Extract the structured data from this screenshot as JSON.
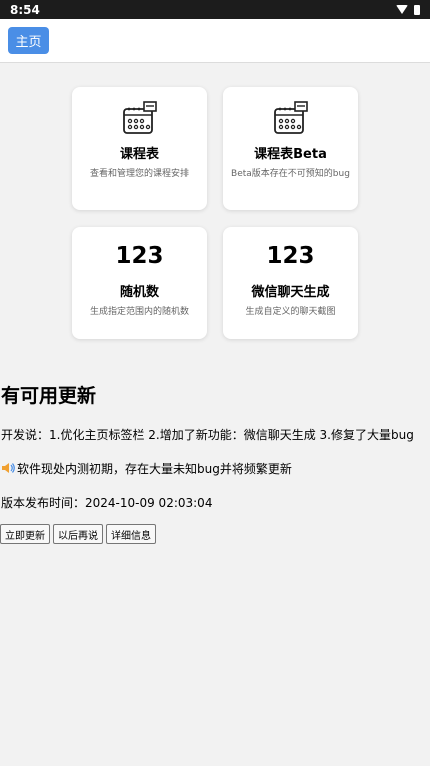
{
  "status_bar": {
    "time": "8:54"
  },
  "topbar": {
    "home_label": "主页"
  },
  "cards": [
    {
      "title": "课程表",
      "desc": "查看和管理您的课程安排",
      "icon": "calendar-grid-icon"
    },
    {
      "title": "课程表Beta",
      "desc": "Beta版本存在不可预知的bug",
      "icon": "calendar-grid-icon"
    },
    {
      "number": "123",
      "title": "随机数",
      "desc": "生成指定范围内的随机数"
    },
    {
      "number": "123",
      "title": "微信聊天生成",
      "desc": "生成自定义的聊天截图"
    }
  ],
  "update": {
    "title": "有可用更新",
    "changelog": "开发说：1.优化主页标签栏 2.增加了新功能：微信聊天生成 3.修复了大量bug",
    "notice": "软件现处内测初期，存在大量未知bug并将频繁更新",
    "release_time": "版本发布时间：2024-10-09 02:03:04",
    "buttons": {
      "update_now": "立即更新",
      "later": "以后再说",
      "details": "详细信息"
    }
  },
  "colors": {
    "accent": "#4a8ee6",
    "status_bar": "#1c1c1c",
    "background": "#f2f2f2"
  }
}
